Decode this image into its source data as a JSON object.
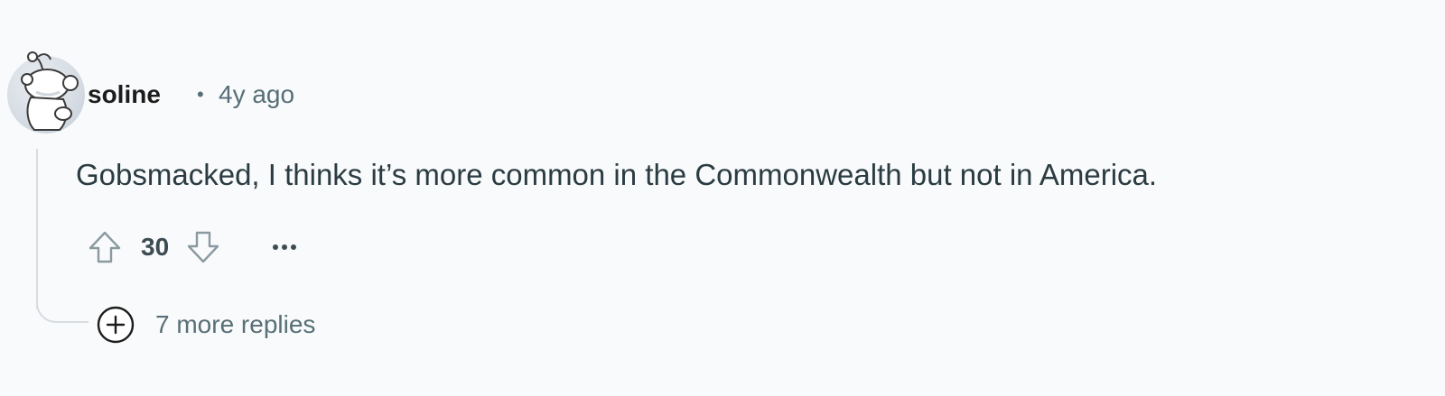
{
  "comment": {
    "author": "soline",
    "separator": "•",
    "timestamp": "4y ago",
    "body": "Gobsmacked, I thinks it’s more common in the Commonwealth but not in America.",
    "score": "30",
    "more_replies_label": "7 more replies"
  },
  "icons": {
    "avatar": "snoo-avatar",
    "upvote": "arrow-up-outline-icon",
    "downvote": "arrow-down-outline-icon",
    "overflow": "ellipsis-icon",
    "expand": "plus-circle-icon"
  },
  "colors": {
    "background": "#f9fafb",
    "meta_text": "#576f76",
    "body_text": "#2a3c42",
    "thread_line": "#d7dce0"
  }
}
